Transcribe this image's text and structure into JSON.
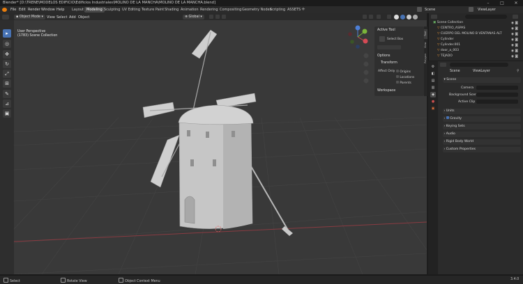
{
  "window": {
    "title": "Blender* [D:\\TRENE\\MODELOS EDIFICIO\\Edificios Industriales\\MOLINO DE LA MANCHA\\MOLINO DE LA MANCHA.blend]",
    "controls": [
      "minimize-icon",
      "maximize-icon",
      "close-icon"
    ]
  },
  "menubar": {
    "menus": [
      "File",
      "Edit",
      "Render",
      "Window",
      "Help"
    ],
    "workspaces": [
      "Layout",
      "Modeling",
      "Sculpting",
      "UV Editing",
      "Texture Paint",
      "Shading",
      "Animation",
      "Rendering",
      "Compositing",
      "Geometry Nodes",
      "Scripting",
      "ASSETS"
    ],
    "active_workspace": "Modeling",
    "scene_label": "Scene",
    "viewlayer_label": "ViewLayer"
  },
  "viewport_header": {
    "mode": "Object Mode",
    "menus": [
      "View",
      "Select",
      "Add",
      "Object"
    ],
    "transform": "Global",
    "options": "Options"
  },
  "viewport": {
    "perspective_label": "User Perspective",
    "collection_label": "(1783) Scene Collection"
  },
  "tools": [
    "select-box-icon",
    "cursor-icon",
    "move-icon",
    "rotate-icon",
    "scale-icon",
    "transform-icon",
    "annotate-icon",
    "measure-icon",
    "add-cube-icon"
  ],
  "npanel": {
    "active_tool_title": "Active Tool",
    "active_tool_name": "Select Box",
    "options_title": "Options",
    "transform_title": "Transform",
    "affect_only": "Affect Only",
    "origins": "Origins",
    "locations": "Locations",
    "parents": "Parents",
    "workspace_title": "Workspace",
    "tabs": [
      "Tool",
      "View",
      "Polygon"
    ]
  },
  "outliner": {
    "root": "Scene Collection",
    "rows": [
      {
        "name": "CENTRO_ASPAS"
      },
      {
        "name": "CUERPO DEL MOLINO B VENTANAS ALT"
      },
      {
        "name": "Cylinder"
      },
      {
        "name": "Cylinder.001"
      },
      {
        "name": "door_a_003"
      },
      {
        "name": "TEJADO"
      }
    ]
  },
  "properties": {
    "breadcrumb_scene": "Scene",
    "breadcrumb_viewlayer": "ViewLayer",
    "scene_section": "Scene",
    "camera_label": "Camera",
    "background_label": "Background Scene",
    "active_clip_label": "Active Clip",
    "sections": [
      "Units",
      "Gravity",
      "Keying Sets",
      "Audio",
      "Rigid Body World",
      "Custom Properties"
    ]
  },
  "statusbar": {
    "select": "Select",
    "rotate": "Rotate View",
    "context": "Object Context Menu",
    "version": "3.4.0"
  },
  "colors": {
    "accent": "#4772b3",
    "viewport_bg": "#393939",
    "panel_bg": "#2b2b2b",
    "x_axis": "#d44a55",
    "y_axis": "#7bb43a",
    "z_axis": "#4d7fd6"
  }
}
